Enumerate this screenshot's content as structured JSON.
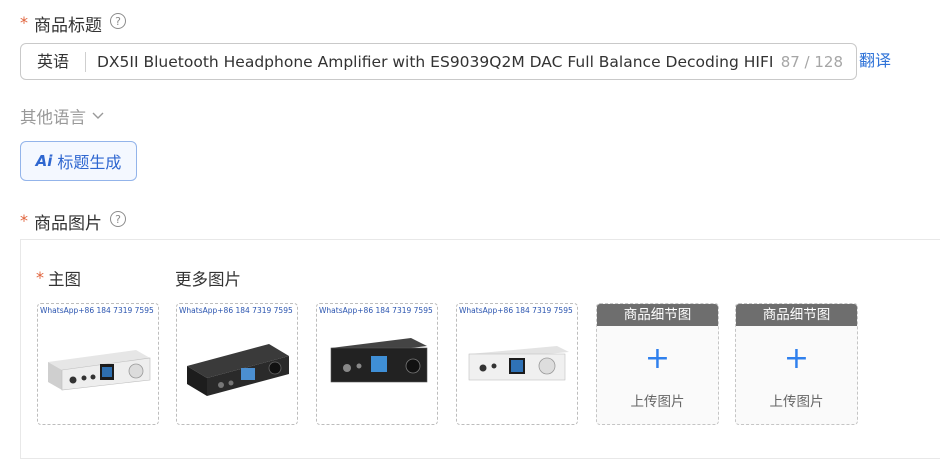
{
  "title_field": {
    "required_mark": "*",
    "label": "商品标题",
    "help_icon": "question-circle-icon",
    "language": "英语",
    "value": "DX5II Bluetooth Headphone Amplifier with ES9039Q2M DAC Full Balance Decoding HIFI",
    "char_count": "87 / 128",
    "translate_label": "翻译"
  },
  "other_languages": {
    "label": "其他语言",
    "icon": "chevron-down-icon"
  },
  "ai_button": {
    "icon_text": "Ai",
    "label": "标题生成"
  },
  "images_field": {
    "required_mark": "*",
    "label": "商品图片",
    "help_icon": "question-circle-icon",
    "main_required_mark": "*",
    "main_label": "主图",
    "more_label": "更多图片",
    "thumbnails": [
      {
        "watermark": "WhatsApp+86 184 7319 7595",
        "device_color": "silver"
      },
      {
        "watermark": "WhatsApp+86 184 7319 7595",
        "device_color": "black"
      },
      {
        "watermark": "WhatsApp+86 184 7319 7595",
        "device_color": "black"
      },
      {
        "watermark": "WhatsApp+86 184 7319 7595",
        "device_color": "silver"
      }
    ],
    "upload_slots": [
      {
        "header": "商品细节图",
        "plus": "+",
        "text": "上传图片"
      },
      {
        "header": "商品细节图",
        "plus": "+",
        "text": "上传图片"
      }
    ]
  },
  "colors": {
    "accent": "#2f80ed",
    "required": "#e0623b",
    "link": "#2f73d8"
  }
}
